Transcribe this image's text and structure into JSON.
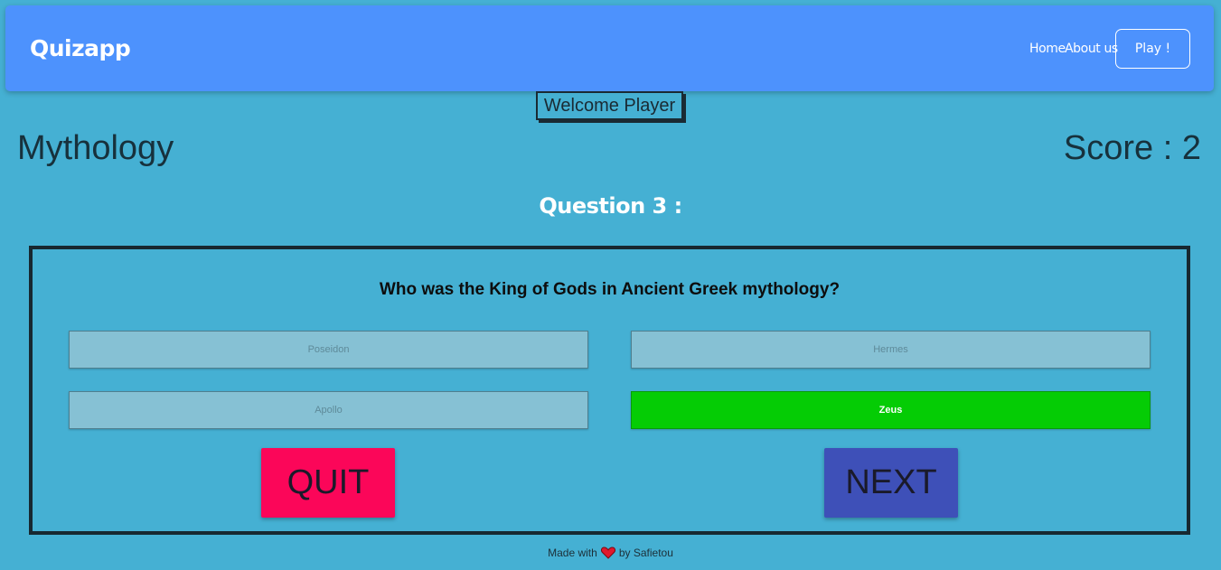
{
  "navbar": {
    "brand": "Quizapp",
    "links": [
      {
        "label": "Home"
      },
      {
        "label": "About us"
      }
    ],
    "play_label": "Play !"
  },
  "welcome": "Welcome Player",
  "category": "Mythology",
  "score": "Score : 2",
  "question_heading": "Question 3 :",
  "question": {
    "text": "Who was the King of Gods in Ancient Greek mythology?",
    "answers": [
      {
        "label": "Poseidon",
        "state": "default"
      },
      {
        "label": "Hermes",
        "state": "default"
      },
      {
        "label": "Apollo",
        "state": "default"
      },
      {
        "label": "Zeus",
        "state": "correct"
      }
    ]
  },
  "actions": {
    "quit_label": "QUIT",
    "next_label": "NEXT"
  },
  "footer": {
    "prefix": "Made with",
    "icon": "heart-icon",
    "suffix": "by Safietou"
  },
  "colors": {
    "background": "#45b0d3",
    "navbar": "#4d92fd",
    "answer_default": "#86c1d4",
    "answer_correct": "#05cc05",
    "quit": "#fb0659",
    "next": "#3e50b8",
    "heart": "#e0182d"
  }
}
